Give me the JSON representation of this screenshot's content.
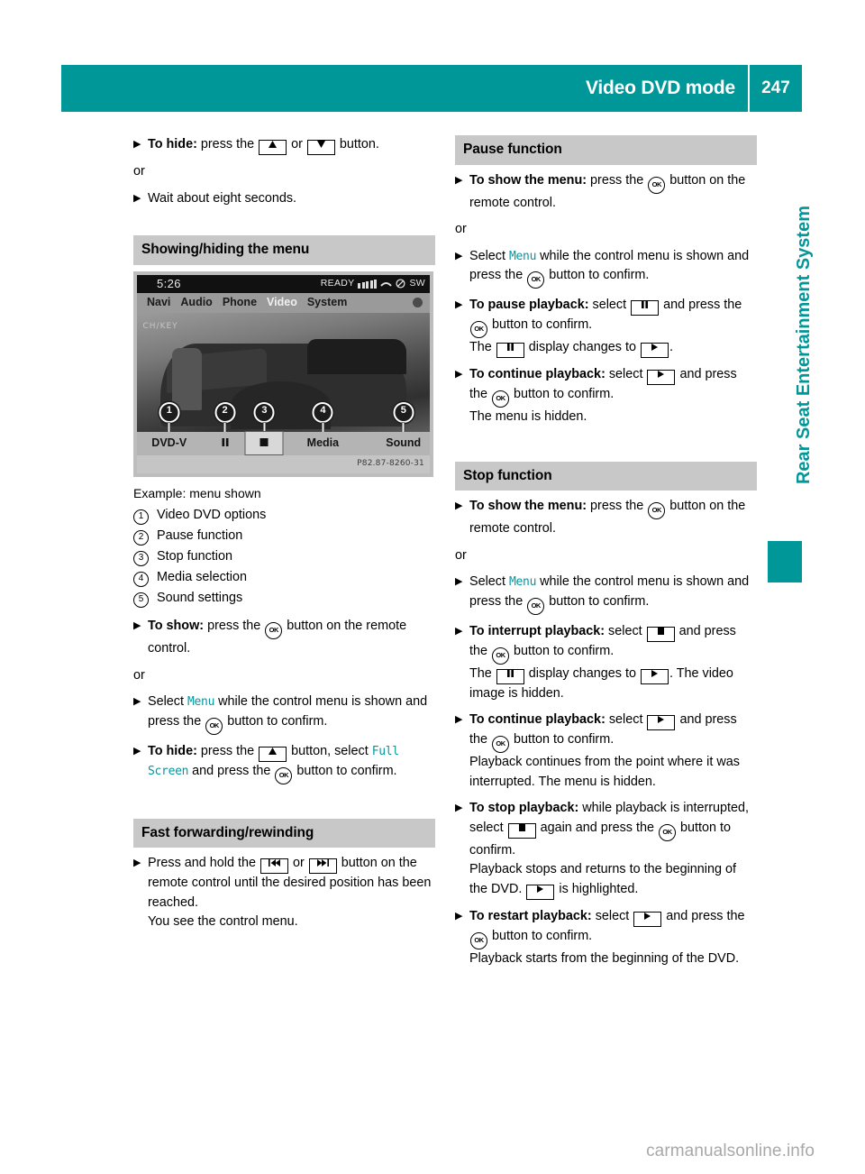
{
  "header": {
    "title": "Video DVD mode",
    "page_number": "247"
  },
  "side_tab": {
    "label": "Rear Seat Entertainment System"
  },
  "watermark": {
    "text": "carmanualsonline.info"
  },
  "left_column": {
    "step_to_hide_lead": "To hide:",
    "step_to_hide_tail_1": " press the ",
    "step_to_hide_or": " or ",
    "step_to_hide_tail_2": " button.",
    "or_1": "or",
    "step_wait": "Wait about eight seconds.",
    "section_showing_hiding": "Showing/hiding the menu",
    "caption": "Example: menu shown",
    "legend": [
      {
        "num": "1",
        "text": "Video DVD options"
      },
      {
        "num": "2",
        "text": "Pause function"
      },
      {
        "num": "3",
        "text": "Stop function"
      },
      {
        "num": "4",
        "text": "Media selection"
      },
      {
        "num": "5",
        "text": "Sound settings"
      }
    ],
    "step_to_show_lead": "To show:",
    "step_to_show_tail_1": " press the ",
    "step_to_show_tail_2": " button on the remote control.",
    "or_2": "or",
    "step_select_menu_1": "Select ",
    "menu_term": "Menu",
    "step_select_menu_2": " while the control menu is shown and press the ",
    "step_select_menu_3": " button to confirm.",
    "step_hide_menu_lead": "To hide:",
    "step_hide_menu_1": " press the ",
    "step_hide_menu_2": " button, select ",
    "full_screen_term": "Full Screen",
    "step_hide_menu_3": " and press the ",
    "step_hide_menu_4": " button to confirm.",
    "section_fast_forward": "Fast forwarding/rewinding",
    "step_ff_1": "Press and hold the ",
    "step_ff_or": " or ",
    "step_ff_2": " button on the remote control until the desired position has been reached.",
    "step_ff_3": "You see the control menu."
  },
  "right_column": {
    "section_pause": "Pause function",
    "pause_show_lead": "To show the menu:",
    "pause_show_tail_1": " press the ",
    "pause_show_tail_2": " button on the remote control.",
    "or_1": "or",
    "pause_select_1": "Select ",
    "menu_term": "Menu",
    "pause_select_2": " while the control menu is shown and press the ",
    "pause_select_3": " button to confirm.",
    "pause_playback_lead": "To pause playback:",
    "pause_playback_1": " select ",
    "pause_playback_2": " and press the ",
    "pause_playback_3": " button to confirm.",
    "pause_playback_4": "The ",
    "pause_playback_5": " display changes to ",
    "pause_playback_6": ".",
    "continue_lead": "To continue playback:",
    "continue_1": " select ",
    "continue_2": " and press the ",
    "continue_3": " button to confirm.",
    "continue_4": "The menu is hidden.",
    "section_stop": "Stop function",
    "stop_show_lead": "To show the menu:",
    "stop_show_tail_1": " press the ",
    "stop_show_tail_2": " button on the remote control.",
    "or_2": "or",
    "stop_select_1": "Select ",
    "stop_select_2": " while the control menu is shown and press the ",
    "stop_select_3": " button to confirm.",
    "interrupt_lead": "To interrupt playback:",
    "interrupt_1": " select ",
    "interrupt_2": " and press the ",
    "interrupt_3": " button to confirm.",
    "interrupt_4": "The ",
    "interrupt_5": " display changes to ",
    "interrupt_6": ". The video image is hidden.",
    "continue2_lead": "To continue playback:",
    "continue2_1": " select ",
    "continue2_2": " and press the ",
    "continue2_3": " button to confirm.",
    "continue2_4": "Playback continues from the point where it was interrupted. The menu is hidden.",
    "stop_playback_lead": "To stop playback:",
    "stop_playback_1": " while playback is interrupted, select ",
    "stop_playback_2": " again and press the ",
    "stop_playback_3": " button to confirm.",
    "stop_playback_4": "Playback stops and returns to the beginning of the DVD. ",
    "stop_playback_5": " is highlighted.",
    "restart_lead": "To restart playback:",
    "restart_1": " select ",
    "restart_2": " and press the ",
    "restart_3": " button to confirm.",
    "restart_4": "Playback starts from the beginning of the DVD."
  },
  "device_screenshot": {
    "clock": "5:26",
    "status_ready": "READY",
    "status_sw": "SW",
    "menu_items": [
      "Navi",
      "Audio",
      "Phone",
      "Video",
      "System"
    ],
    "active_menu_item": "Video",
    "softkeys": [
      "DVD-V",
      "pause-icon",
      "stop-icon",
      "Media",
      "Sound"
    ],
    "softkey_labels": {
      "left": "DVD-V",
      "media": "Media",
      "sound": "Sound"
    },
    "callout_numbers": [
      "1",
      "2",
      "3",
      "4",
      "5"
    ],
    "image_code": "P82.87-8260-31",
    "graffiti": "CH/KEY"
  },
  "glyphs": {
    "ok": "OK",
    "up": "up-arrow",
    "down": "down-arrow",
    "rewind": "rewind",
    "fast_forward": "fast-forward",
    "pause": "pause",
    "play": "play",
    "stop": "stop"
  },
  "colors": {
    "accent_teal": "#009799",
    "section_grey": "#c8c8c8",
    "menu_term_teal": "#0098a0",
    "watermark_grey": "#a8a8a8"
  }
}
